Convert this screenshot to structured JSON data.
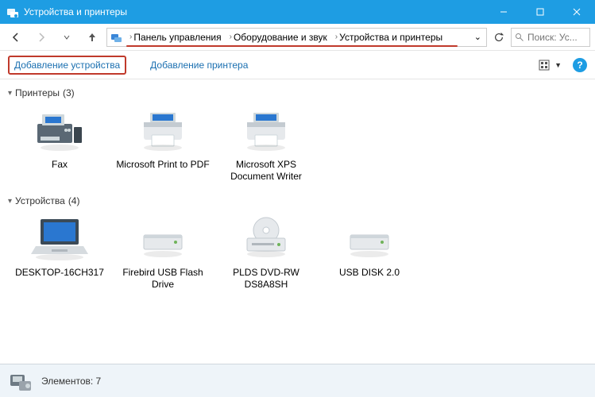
{
  "window": {
    "title": "Устройства и принтеры"
  },
  "breadcrumb": {
    "segments": [
      "Панель управления",
      "Оборудование и звук",
      "Устройства и принтеры"
    ]
  },
  "search": {
    "placeholder": "Поиск: Ус..."
  },
  "toolbar": {
    "add_device": "Добавление устройства",
    "add_printer": "Добавление принтера"
  },
  "groups": [
    {
      "title": "Принтеры",
      "count": "(3)",
      "items": [
        {
          "label": "Fax",
          "icon": "fax"
        },
        {
          "label": "Microsoft Print to PDF",
          "icon": "printer"
        },
        {
          "label": "Microsoft XPS Document Writer",
          "icon": "printer"
        }
      ]
    },
    {
      "title": "Устройства",
      "count": "(4)",
      "items": [
        {
          "label": "DESKTOP-16CH317",
          "icon": "laptop"
        },
        {
          "label": "Firebird USB Flash Drive",
          "icon": "drive"
        },
        {
          "label": "PLDS DVD-RW DS8A8SH",
          "icon": "optical"
        },
        {
          "label": "USB DISK 2.0",
          "icon": "drive"
        }
      ]
    }
  ],
  "status": {
    "text": "Элементов: 7"
  }
}
